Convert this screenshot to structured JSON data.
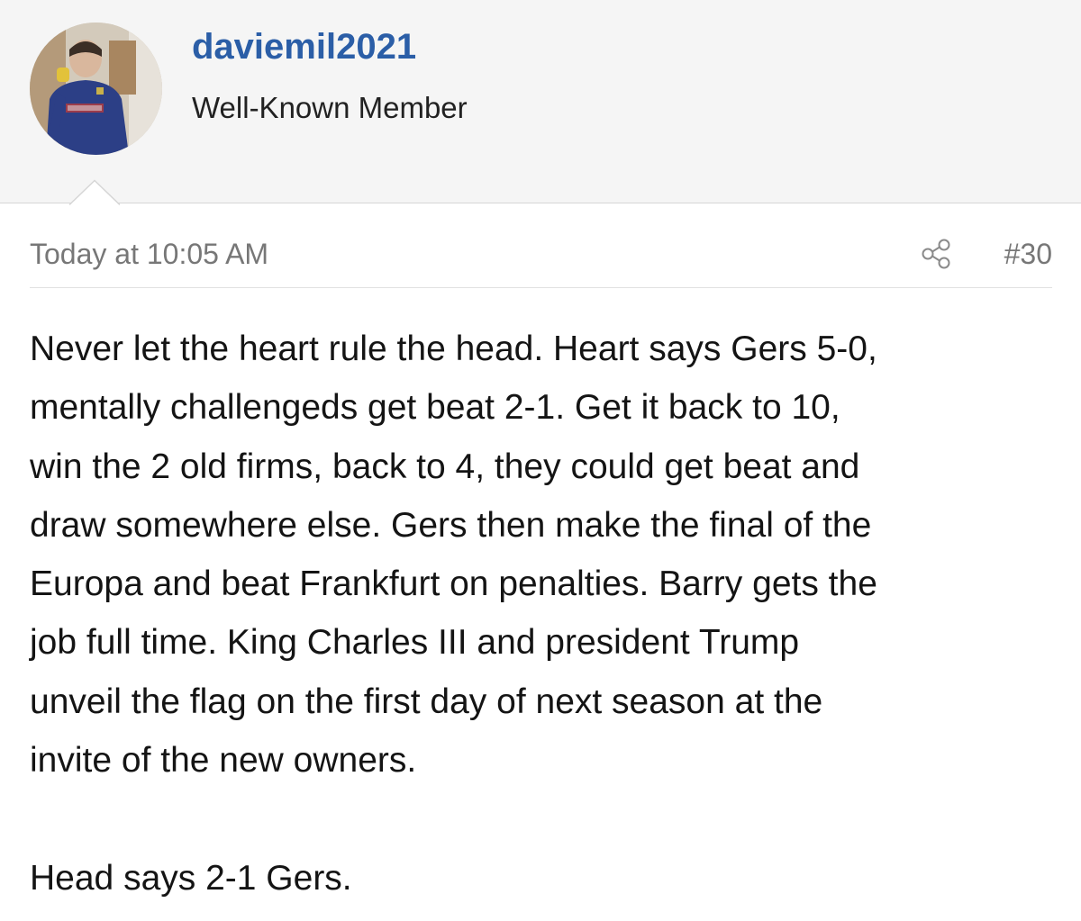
{
  "user": {
    "username": "daviemil2021",
    "title": "Well-Known Member"
  },
  "post": {
    "timestamp": "Today at 10:05 AM",
    "number": "#30",
    "lines": [
      "Never let the heart rule the head. Heart says Gers 5-0,",
      "mentally challengeds get beat 2-1. Get it back to 10,",
      "win the 2 old firms, back to 4, they could get beat and",
      "draw somewhere else. Gers then make the final of the",
      "Europa and beat Frankfurt on penalties. Barry gets the",
      "job full time. King Charles III and president Trump",
      "unveil the flag on the first day of next season at the",
      "invite of the new owners."
    ],
    "closing_line": "Head says 2-1 Gers."
  },
  "icons": {
    "share": "share-icon",
    "avatar": "avatar-photo"
  },
  "colors": {
    "username": "#2b5ea7",
    "header_bg": "#f5f5f5",
    "meta_text": "#777777",
    "body_text": "#141414"
  }
}
